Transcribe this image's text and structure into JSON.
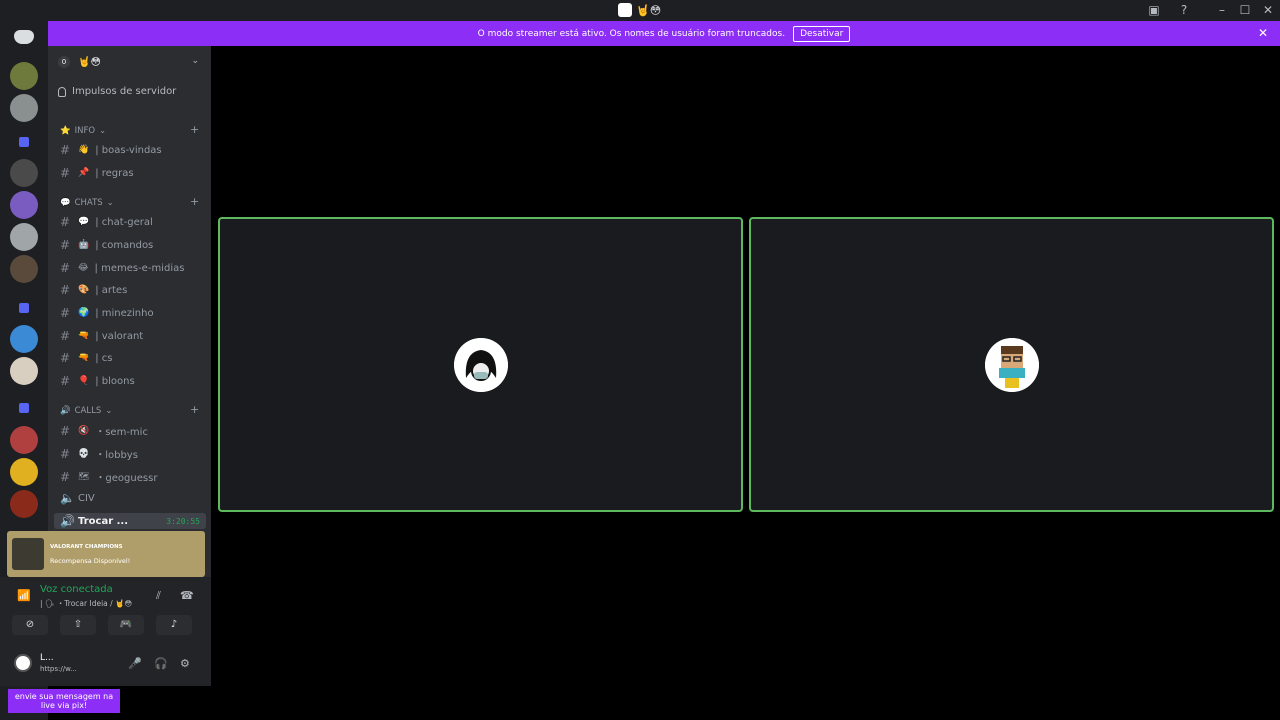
{
  "titlebar": {
    "server_emojis": "🤘😳",
    "icons": [
      "inbox-icon",
      "help-icon",
      "minimize-icon",
      "maximize-icon",
      "close-icon"
    ]
  },
  "banner": {
    "text": "O modo streamer está ativo. Os nomes de usuário foram truncados.",
    "button_label": "Desativar",
    "close": "✕"
  },
  "server": {
    "badge": "0",
    "name": "🤘😳",
    "boost_label": "Impulsos de servidor"
  },
  "categories": {
    "info": "INFO",
    "chats": "CHATS",
    "calls": "CALLS"
  },
  "channels": {
    "info": [
      {
        "emoji": "👋",
        "name": "| boas-vindas"
      },
      {
        "emoji": "📌",
        "name": "| regras"
      }
    ],
    "chats": [
      {
        "emoji": "💬",
        "name": "| chat-geral"
      },
      {
        "emoji": "🤖",
        "name": "| comandos"
      },
      {
        "emoji": "😂",
        "name": "| memes-e-midias"
      },
      {
        "emoji": "🎨",
        "name": "| artes"
      },
      {
        "emoji": "🌍",
        "name": "| minezinho"
      },
      {
        "emoji": "🔫",
        "name": "| valorant"
      },
      {
        "emoji": "🔫",
        "name": "| cs"
      },
      {
        "emoji": "🎈",
        "name": "| bloons"
      }
    ],
    "calls": [
      {
        "emoji": "🔇",
        "name": "・sem-mic"
      },
      {
        "emoji": "💀",
        "name": "・lobbys"
      },
      {
        "emoji": "🗺",
        "name": "・geoguessr"
      },
      {
        "emoji": "",
        "name": "CIV"
      }
    ],
    "active": {
      "name": "Trocar ...",
      "time": "3:20:55"
    }
  },
  "promo": {
    "title": "VALORANT CHAMPIONS",
    "text": "Recompensa Disponível!"
  },
  "voice": {
    "status": "Voz conectada",
    "channel": "| 🗣 ・Trocar Ideia / 🤘😳"
  },
  "user": {
    "name": "L...",
    "status": "https://w..."
  },
  "pix": {
    "text": "envie sua mensagem na live via pix!"
  },
  "colors": {
    "banner": "#8c2ef5",
    "speaking_border": "#5eb85e",
    "voice_green": "#23a559",
    "sidebar": "#2b2d31",
    "rail": "#1e1f22"
  }
}
